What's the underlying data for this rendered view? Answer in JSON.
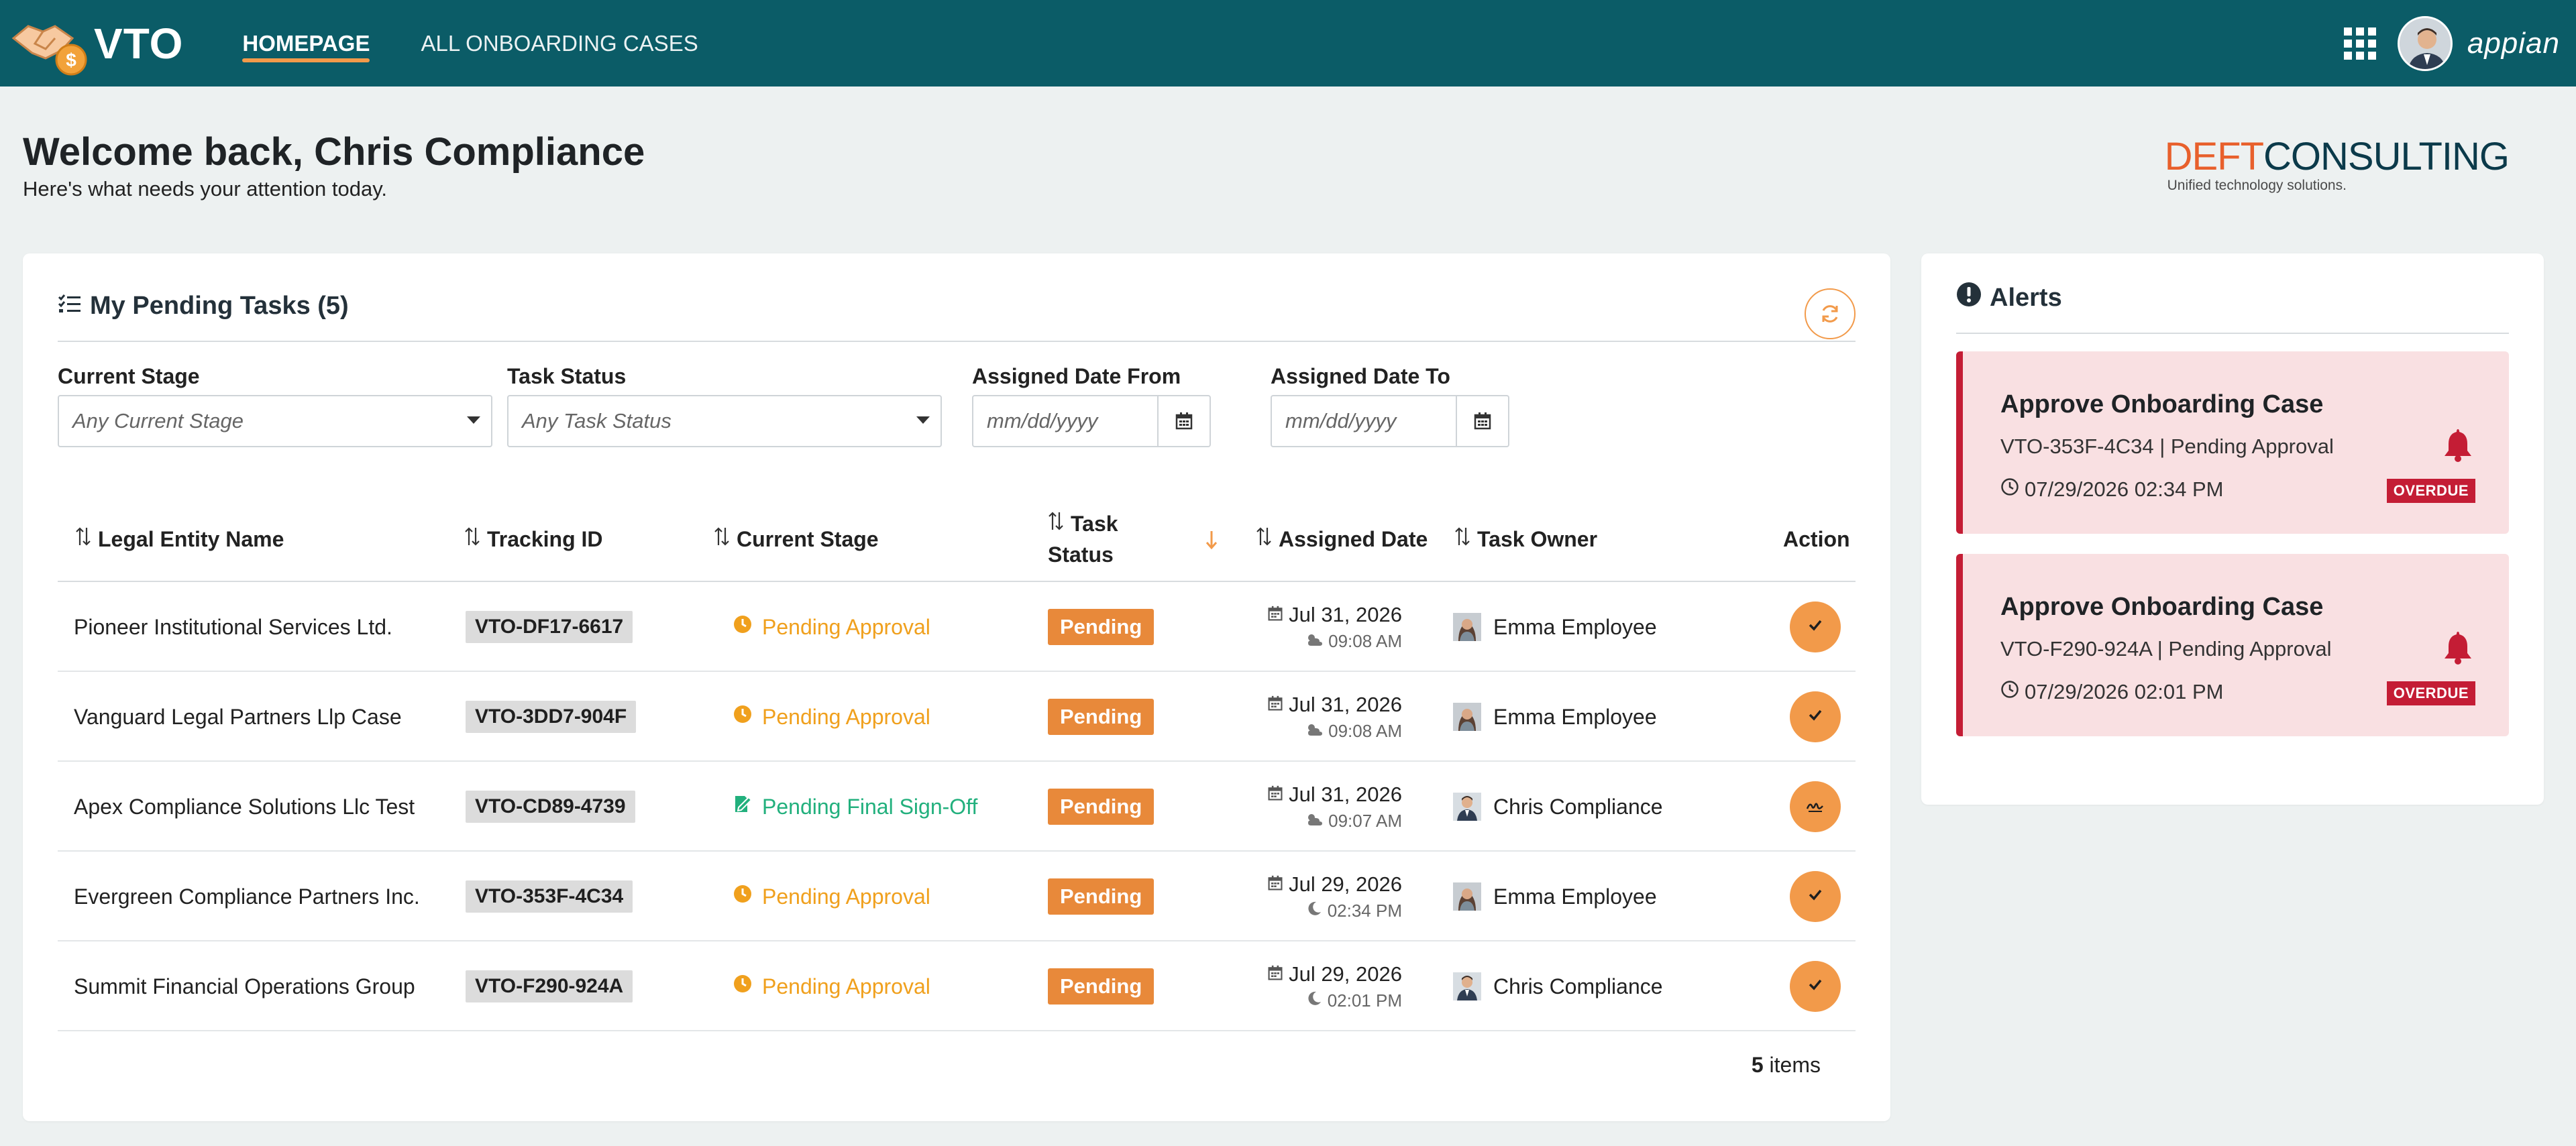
{
  "app": {
    "logo_text": "VTO",
    "brand": "appian",
    "nav": [
      {
        "label": "HOMEPAGE",
        "active": true
      },
      {
        "label": "ALL ONBOARDING CASES",
        "active": false
      }
    ]
  },
  "welcome": {
    "title": "Welcome back, Chris Compliance",
    "subtitle": "Here's what needs your attention today."
  },
  "company": {
    "name_part1": "DEFT",
    "name_part2": "CONSULTING",
    "tagline": "Unified technology solutions."
  },
  "tasks": {
    "title": "My Pending Tasks (5)",
    "filters": {
      "stage_label": "Current Stage",
      "stage_placeholder": "Any Current Stage",
      "status_label": "Task Status",
      "status_placeholder": "Any Task Status",
      "date_from_label": "Assigned Date From",
      "date_from_placeholder": "mm/dd/yyyy",
      "date_to_label": "Assigned Date To",
      "date_to_placeholder": "mm/dd/yyyy"
    },
    "columns": {
      "entity": "Legal Entity Name",
      "tracking": "Tracking ID",
      "stage": "Current Stage",
      "status_line1": "Task",
      "status_line2": "Status",
      "assigned": "Assigned Date",
      "owner": "Task Owner",
      "action": "Action"
    },
    "rows": [
      {
        "entity": "Pioneer Institutional Services Ltd.",
        "tracking": "VTO-DF17-6617",
        "stage": "Pending Approval",
        "stage_type": "approval",
        "status": "Pending",
        "date": "Jul 31, 2026",
        "time": "09:08 AM",
        "owner": "Emma Employee",
        "owner_type": "female",
        "action_icon": "check-icon"
      },
      {
        "entity": "Vanguard Legal Partners Llp Case",
        "tracking": "VTO-3DD7-904F",
        "stage": "Pending Approval",
        "stage_type": "approval",
        "status": "Pending",
        "date": "Jul 31, 2026",
        "time": "09:08 AM",
        "owner": "Emma Employee",
        "owner_type": "female",
        "action_icon": "check-icon"
      },
      {
        "entity": "Apex Compliance Solutions Llc Test",
        "tracking": "VTO-CD89-4739",
        "stage": "Pending Final Sign-Off",
        "stage_type": "signoff",
        "status": "Pending",
        "date": "Jul 31, 2026",
        "time": "09:07 AM",
        "owner": "Chris Compliance",
        "owner_type": "male",
        "action_icon": "signature-icon"
      },
      {
        "entity": "Evergreen Compliance Partners Inc.",
        "tracking": "VTO-353F-4C34",
        "stage": "Pending Approval",
        "stage_type": "approval",
        "status": "Pending",
        "date": "Jul 29, 2026",
        "time": "02:34 PM",
        "owner": "Emma Employee",
        "owner_type": "female",
        "action_icon": "check-icon"
      },
      {
        "entity": "Summit Financial Operations Group",
        "tracking": "VTO-F290-924A",
        "stage": "Pending Approval",
        "stage_type": "approval",
        "status": "Pending",
        "date": "Jul 29, 2026",
        "time": "02:01 PM",
        "owner": "Chris Compliance",
        "owner_type": "male",
        "action_icon": "check-icon"
      }
    ],
    "items_count": "5",
    "items_label": "items"
  },
  "alerts": {
    "title": "Alerts",
    "items": [
      {
        "title": "Approve Onboarding Case",
        "subtitle": "VTO-353F-4C34 | Pending Approval",
        "time": "07/29/2026 02:34 PM",
        "badge": "OVERDUE"
      },
      {
        "title": "Approve Onboarding Case",
        "subtitle": "VTO-F290-924A | Pending Approval",
        "time": "07/29/2026 02:01 PM",
        "badge": "OVERDUE"
      }
    ]
  },
  "colors": {
    "topbar": "#0b5c67",
    "accent": "#f29a4a",
    "approval": "#f0a01d",
    "signoff": "#22b07d",
    "alert": "#c41d35"
  }
}
